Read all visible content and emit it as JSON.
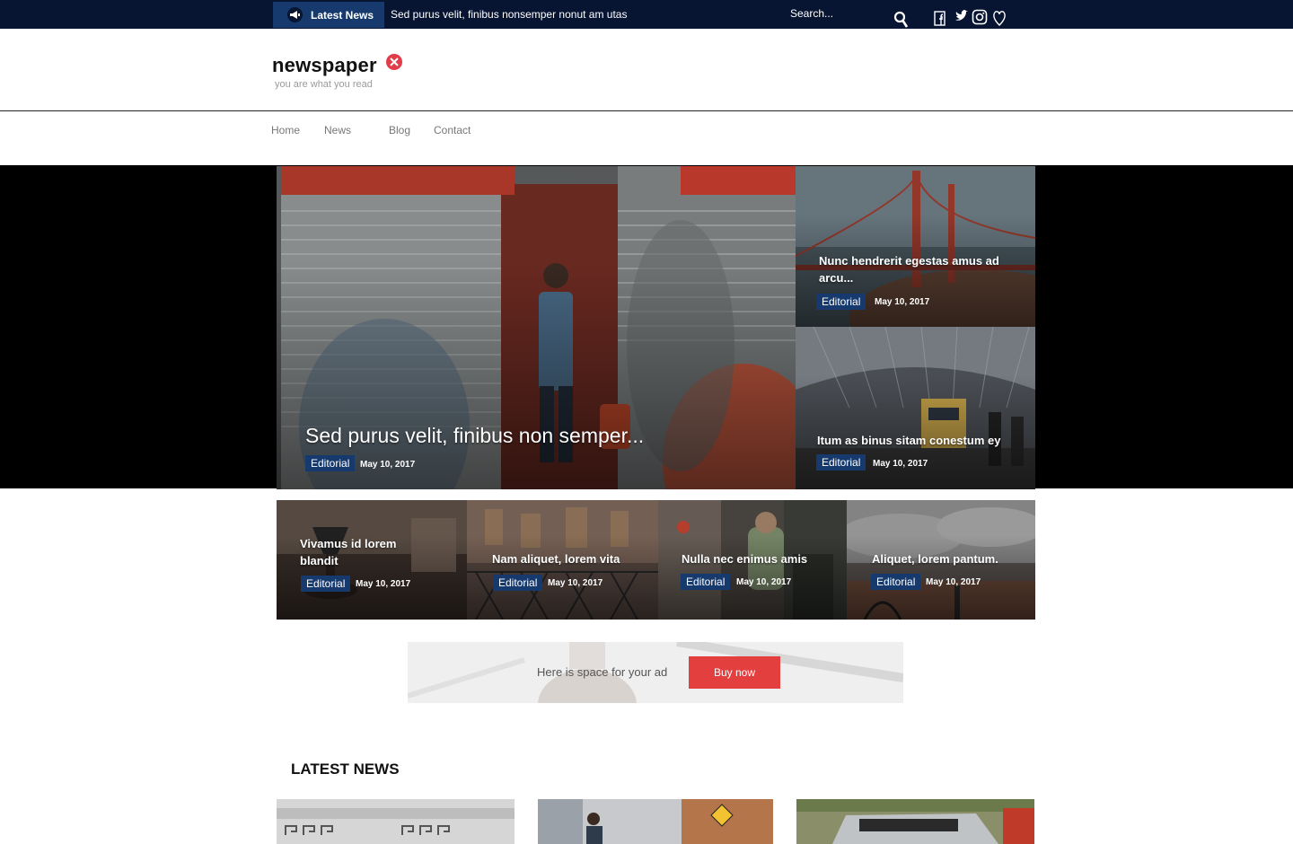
{
  "topbar": {
    "latest_label": "Latest News",
    "ticker_text": "Sed purus velit, finibus nonsemper nonut am utas",
    "search_placeholder": "Search...",
    "icons": [
      "megaphone-icon",
      "search-icon",
      "facebook-icon",
      "twitter-icon",
      "instagram-icon",
      "heart-icon"
    ]
  },
  "brand": {
    "logo_text": "newspaper",
    "tagline": "you are what you read"
  },
  "nav": {
    "items": [
      "Home",
      "News",
      "Blog",
      "Contact"
    ]
  },
  "featured": {
    "main": {
      "title": "Sed purus velit, finibus non semper...",
      "category": "Editorial",
      "date": "May 10, 2017"
    },
    "side": [
      {
        "title": "Nunc hendrerit egestas amus ad arcu...",
        "category": "Editorial",
        "date": "May 10, 2017"
      },
      {
        "title": "Itum as binus sitam conestum ey",
        "category": "Editorial",
        "date": "May 10, 2017"
      }
    ]
  },
  "strip": [
    {
      "title": "Vivamus id lorem blandit",
      "category": "Editorial",
      "date": "May 10, 2017"
    },
    {
      "title": "Nam aliquet, lorem vita",
      "category": "Editorial",
      "date": "May 10, 2017"
    },
    {
      "title": "Nulla nec enimus amis",
      "category": "Editorial",
      "date": "May 10, 2017"
    },
    {
      "title": "Aliquet, lorem pantum.",
      "category": "Editorial",
      "date": "May 10, 2017"
    }
  ],
  "ad": {
    "text": "Here is space for your ad",
    "button_label": "Buy now"
  },
  "latest": {
    "title": "LATEST NEWS"
  },
  "colors": {
    "topbar": "#071533",
    "category_badge": "#163a6d",
    "accent_red": "#e33f3f"
  }
}
